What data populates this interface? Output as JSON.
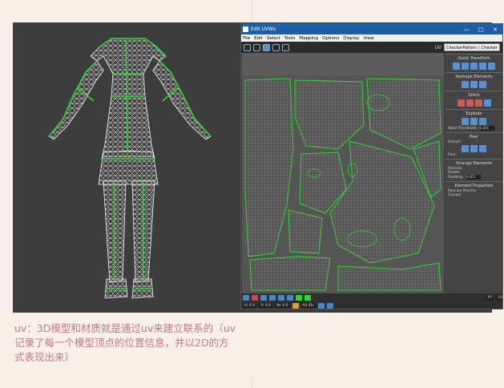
{
  "window": {
    "title": "Edit UVWs",
    "btn_min": "—",
    "btn_max": "□",
    "btn_close": "✕"
  },
  "menu": [
    "File",
    "Edit",
    "Select",
    "Tools",
    "Mapping",
    "Options",
    "Display",
    "View"
  ],
  "toolbar": {
    "uv_label": "UV",
    "checker_value": "CheckerPattern ( Checker )"
  },
  "panel": {
    "quick_transform": "Quick Transform",
    "reshape": "Reshape Elements",
    "stitch": "Stitch",
    "explode": "Explode",
    "weld": "Weld",
    "threshold": "Threshold:",
    "threshold_val": "0.001",
    "peel": "Peel",
    "detach": "Detach",
    "pins": "Pins:",
    "arrange": "Arrange Elements",
    "rescale": "Rescale",
    "rotate": "Rotate",
    "padding": "Padding:",
    "padding_val": "0.001",
    "elem_props": "Element Properties",
    "rescale_priority": "Rescale Priority:",
    "groups": "Groups:"
  },
  "bottom": {
    "u": "U: 0.0",
    "v": "V: 0.0",
    "w": "W: 0.0",
    "allid": "All IDs",
    "xy": "XY",
    "num": "16"
  },
  "caption": "uv：3D模型和材质就是通过uv来建立联系的（uv\n记录了每一个模型顶点的位置信息，并以2D的方\n式表现出来）",
  "colors": {
    "accent_caption": "#c07a8a",
    "wire_green": "#2fd62f",
    "title_blue": "#1c5ea8"
  }
}
